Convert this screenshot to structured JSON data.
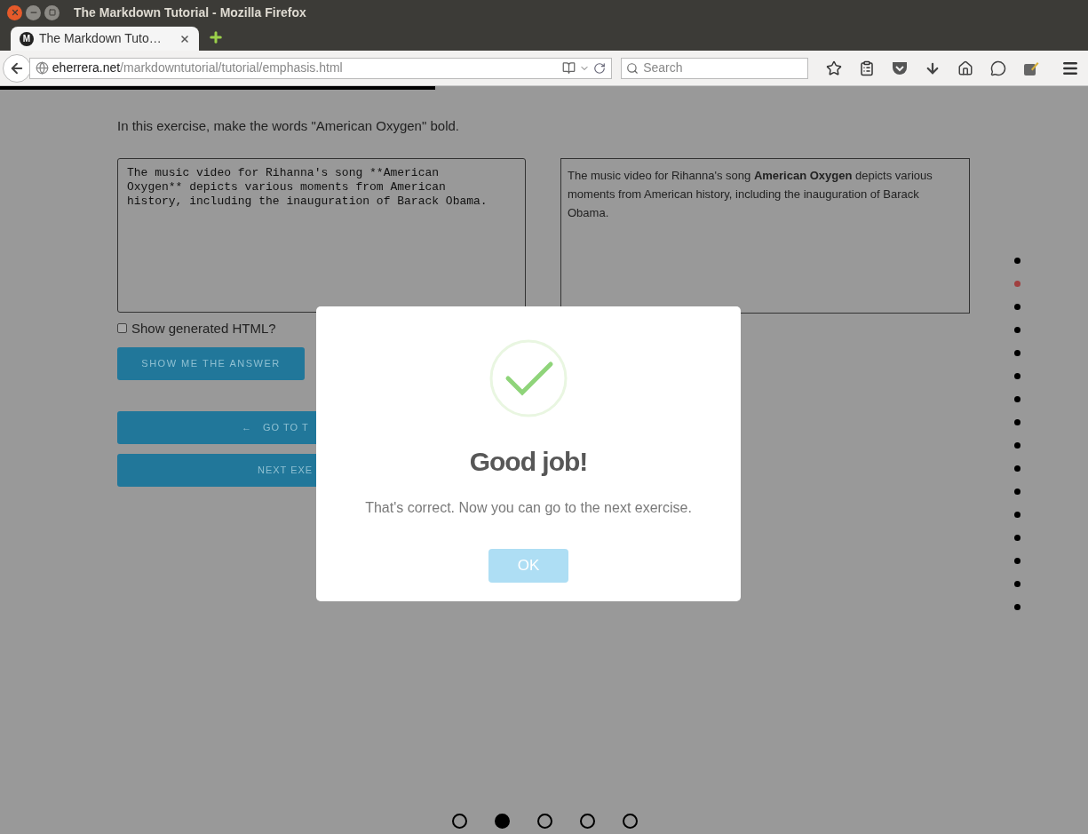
{
  "window": {
    "title": "The Markdown Tutorial - Mozilla Firefox"
  },
  "tabs": [
    {
      "favicon_text": "M",
      "label": "The Markdown Tuto…",
      "selected": true
    }
  ],
  "address_bar": {
    "domain": "eherrera.net",
    "path": "/markdowntutorial/tutorial/emphasis.html"
  },
  "search": {
    "placeholder": "Search"
  },
  "progress": {
    "level": 0.4
  },
  "exercise": {
    "instruction": "In this exercise, make the words \"American Oxygen\" bold.",
    "editor_value": "The music video for Rihanna's song **American Oxygen** depicts various moments from American history, including the inauguration of Barack Obama.",
    "preview": "The music video for Rihanna's song **American Oxygen** depicts various moments from American history, including the inauguration of Barack Obama.",
    "show_html": {
      "label": "Show generated HTML?",
      "checked": false
    },
    "answer_button": "SHOW ME THE ANSWER",
    "back_button": {
      "arrow": "←",
      "label": "GO TO T"
    },
    "next_button": "NEXT EXE"
  },
  "side_nav": [
    {
      "selected": false
    },
    {
      "selected": true
    },
    {
      "selected": false
    },
    {
      "selected": false
    },
    {
      "selected": false
    },
    {
      "selected": false
    },
    {
      "selected": false
    },
    {
      "selected": false
    },
    {
      "selected": false
    },
    {
      "selected": false
    },
    {
      "selected": false
    },
    {
      "selected": false
    },
    {
      "selected": false
    },
    {
      "selected": false
    },
    {
      "selected": false
    },
    {
      "selected": false
    }
  ],
  "page_dots": [
    {
      "selected": false
    },
    {
      "selected": true
    },
    {
      "selected": false
    },
    {
      "selected": false
    },
    {
      "selected": false
    }
  ],
  "dialog": {
    "title": "Good job!",
    "message": "That's correct. Now you can go to the next exercise.",
    "button": "OK"
  }
}
